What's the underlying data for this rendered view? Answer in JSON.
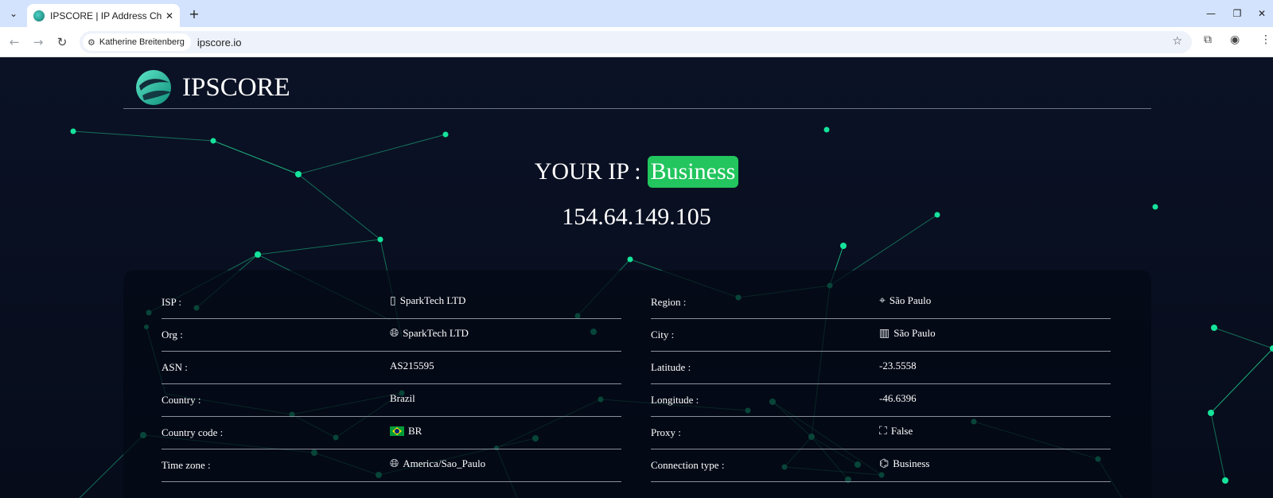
{
  "browser": {
    "tab_title": "IPSCORE | IP Address Checker",
    "profile_chip": "Katherine Breitenberg",
    "url": "ipscore.io",
    "icons": [
      "tab-list-icon",
      "close-icon",
      "plus-icon",
      "minimize-icon",
      "restore-icon",
      "close-window-icon",
      "back-icon",
      "forward-icon",
      "reload-icon",
      "tune-icon",
      "star-icon",
      "extensions-icon",
      "profile-icon",
      "menu-icon"
    ]
  },
  "site": {
    "brand": "IPSCORE"
  },
  "hero": {
    "label": "YOUR IP :",
    "badge": "Business",
    "ip": "154.64.149.105"
  },
  "details": {
    "left": [
      {
        "label": "ISP :",
        "value": "SparkTech LTD",
        "icon": "server-icon"
      },
      {
        "label": "Org :",
        "value": "SparkTech LTD",
        "icon": "globe-icon"
      },
      {
        "label": "ASN :",
        "value": "AS215595",
        "icon": ""
      },
      {
        "label": "Country :",
        "value": "Brazil",
        "icon": ""
      },
      {
        "label": "Country code :",
        "value": "BR",
        "icon": "brazil-flag-icon"
      },
      {
        "label": "Time zone :",
        "value": "America/Sao_Paulo",
        "icon": "globe-icon"
      }
    ],
    "right": [
      {
        "label": "Region :",
        "value": "São Paulo",
        "icon": "map-icon"
      },
      {
        "label": "City :",
        "value": "São Paulo",
        "icon": "city-icon"
      },
      {
        "label": "Latitude :",
        "value": "-23.5558",
        "icon": ""
      },
      {
        "label": "Longitude :",
        "value": "-46.6396",
        "icon": ""
      },
      {
        "label": "Proxy :",
        "value": "False",
        "icon": "proxy-icon"
      },
      {
        "label": "Connection type :",
        "value": "Business",
        "icon": "network-icon"
      }
    ]
  },
  "colors": {
    "page_bg": "#0a1122",
    "accent": "#22c55e",
    "network_node": "#16e39b",
    "network_line": "#1fbf86"
  }
}
